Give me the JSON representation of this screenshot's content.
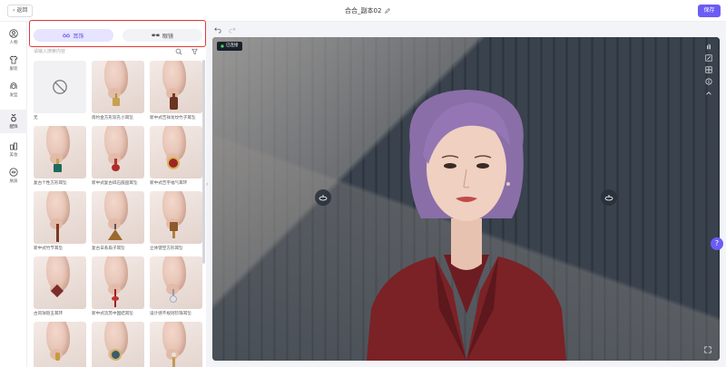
{
  "topbar": {
    "back_label": "返回",
    "title": "合合_副本02",
    "save_label": "保存"
  },
  "leftnav": {
    "items": [
      {
        "label": "人物",
        "icon": "person-icon"
      },
      {
        "label": "服装",
        "icon": "clothes-icon"
      },
      {
        "label": "发型",
        "icon": "hair-icon"
      },
      {
        "label": "配饰",
        "icon": "accessory-icon",
        "active": true
      },
      {
        "label": "美妆",
        "icon": "makeup-icon"
      },
      {
        "label": "肤质",
        "icon": "skin-icon"
      }
    ]
  },
  "panel": {
    "tabs": [
      {
        "label": "耳饰",
        "active": true
      },
      {
        "label": "眼镜",
        "active": false
      }
    ],
    "search_placeholder": "请输入搜索内容",
    "items": [
      {
        "label": "无"
      },
      {
        "label": "简约金方形双孔小耳坠"
      },
      {
        "label": "新中式吉祥龙纹竹子耳坠"
      },
      {
        "label": "复古个性方形耳坠"
      },
      {
        "label": "新中式复古碎石鼓盘耳坠"
      },
      {
        "label": "新中式吉字福气耳环"
      },
      {
        "label": "新中式竹节耳坠"
      },
      {
        "label": "复古日系扇子耳坠"
      },
      {
        "label": "立体镂空方形耳坠"
      },
      {
        "label": "古风珐琅玉耳环"
      },
      {
        "label": "新中式流苏中国结耳坠"
      },
      {
        "label": "设计感不规则珍珠耳坠"
      },
      {
        "label": ""
      },
      {
        "label": ""
      },
      {
        "label": ""
      }
    ]
  },
  "viewport": {
    "badge_label": "已连接",
    "accent": "#6b5cf6"
  },
  "help_label": "?"
}
